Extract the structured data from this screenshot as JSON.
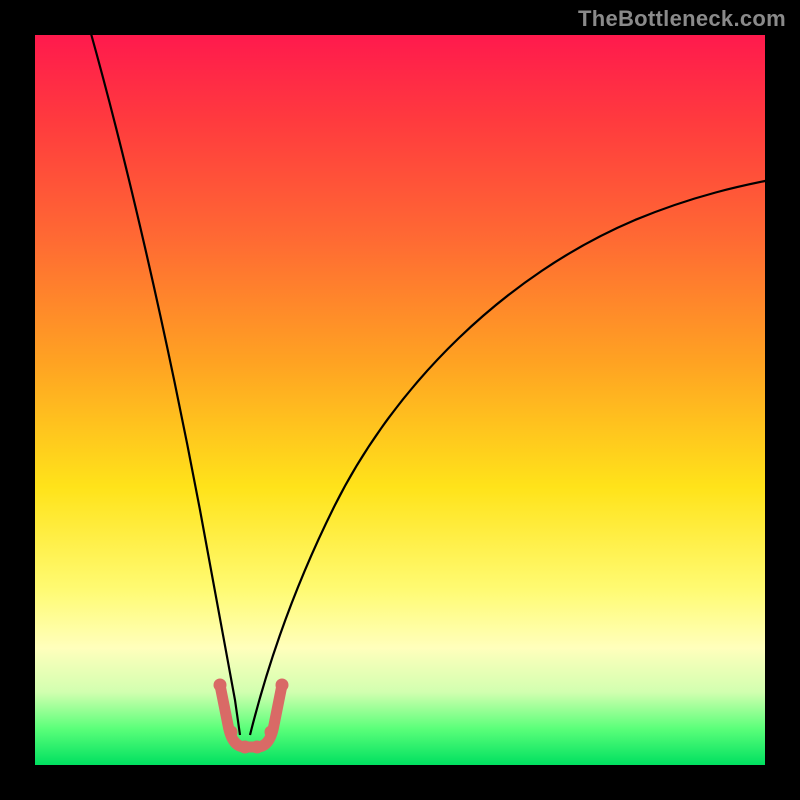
{
  "watermark": "TheBottleneck.com",
  "colors": {
    "frame": "#000000",
    "gradient_top": "#ff1a4d",
    "gradient_bottom": "#00e060",
    "curve": "#000000",
    "marker": "#d96a66"
  },
  "chart_data": {
    "type": "line",
    "title": "",
    "xlabel": "",
    "ylabel": "",
    "xlim": [
      0,
      100
    ],
    "ylim": [
      0,
      100
    ],
    "note": "Axes unlabeled; values are visual percent estimates. Two curve branches descend to a narrow minimum near x≈28, y≈3; a short salmon U-shaped marker highlights the minimum.",
    "series": [
      {
        "name": "left-branch",
        "x": [
          7,
          10,
          13,
          16,
          19,
          22,
          24,
          26,
          27.5
        ],
        "y": [
          100,
          87,
          73,
          59,
          45,
          30,
          18,
          9,
          4
        ]
      },
      {
        "name": "right-branch",
        "x": [
          29,
          31,
          34,
          38,
          43,
          50,
          58,
          67,
          77,
          88,
          100
        ],
        "y": [
          4,
          9,
          18,
          29,
          40,
          50,
          58,
          65,
          71,
          76,
          80
        ]
      }
    ],
    "marker": {
      "name": "minimum-marker",
      "points": [
        {
          "x": 25.5,
          "y": 11
        },
        {
          "x": 26.5,
          "y": 5
        },
        {
          "x": 28.0,
          "y": 3
        },
        {
          "x": 29.5,
          "y": 3
        },
        {
          "x": 31.0,
          "y": 5
        },
        {
          "x": 32.0,
          "y": 11
        }
      ]
    }
  }
}
